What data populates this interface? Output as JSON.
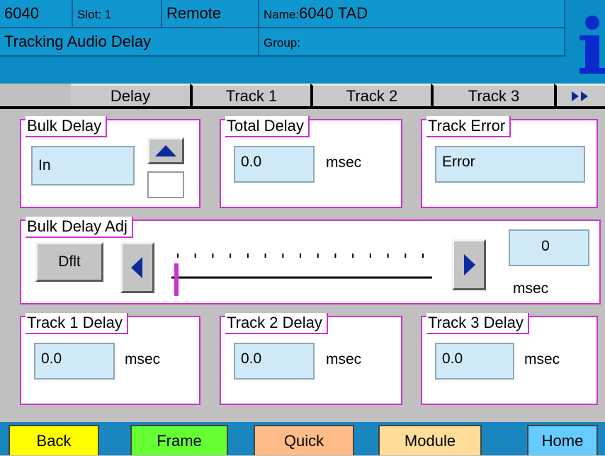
{
  "header": {
    "model": "6040",
    "slot": "Slot: 1",
    "mode": "Remote",
    "name_label": "Name:",
    "name_value": "6040 TAD",
    "module_title": "Tracking Audio Delay",
    "group_label": "Group:",
    "info_icon": "info-icon"
  },
  "tabs": [
    {
      "label": "Delay",
      "active": true
    },
    {
      "label": "Track 1"
    },
    {
      "label": "Track 2"
    },
    {
      "label": "Track 3"
    }
  ],
  "tabs_more_icon": "double-right-arrow-icon",
  "bulk_delay": {
    "label": "Bulk Delay",
    "value": "In",
    "up_icon": "up-arrow-icon"
  },
  "total_delay": {
    "label": "Total Delay",
    "value": "0.0",
    "unit": "msec"
  },
  "track_error": {
    "label": "Track Error",
    "value": "Error"
  },
  "bulk_delay_adj": {
    "label": "Bulk Delay Adj",
    "default_label": "Dflt",
    "value": "0",
    "unit": "msec",
    "slider_fraction": 0.0,
    "tick_count": 15,
    "left_icon": "left-arrow-icon",
    "right_icon": "right-arrow-icon"
  },
  "tracks": [
    {
      "label": "Track 1 Delay",
      "value": "0.0",
      "unit": "msec"
    },
    {
      "label": "Track 2 Delay",
      "value": "0.0",
      "unit": "msec"
    },
    {
      "label": "Track 3 Delay",
      "value": "0.0",
      "unit": "msec"
    }
  ],
  "nav": {
    "back": "Back",
    "frame": "Frame",
    "quick": "Quick",
    "module": "Module",
    "home": "Home",
    "colors": {
      "back": "#ffff00",
      "frame": "#66ff33",
      "quick": "#ffbb88",
      "module": "#ffdd99",
      "home": "#66ccff"
    }
  },
  "colors": {
    "header_bg": "#1097d0",
    "panel_border": "#cc33cc",
    "field_bg": "#cfe9f7",
    "accent": "#0a2b9c",
    "slider_thumb": "#cc33cc"
  }
}
